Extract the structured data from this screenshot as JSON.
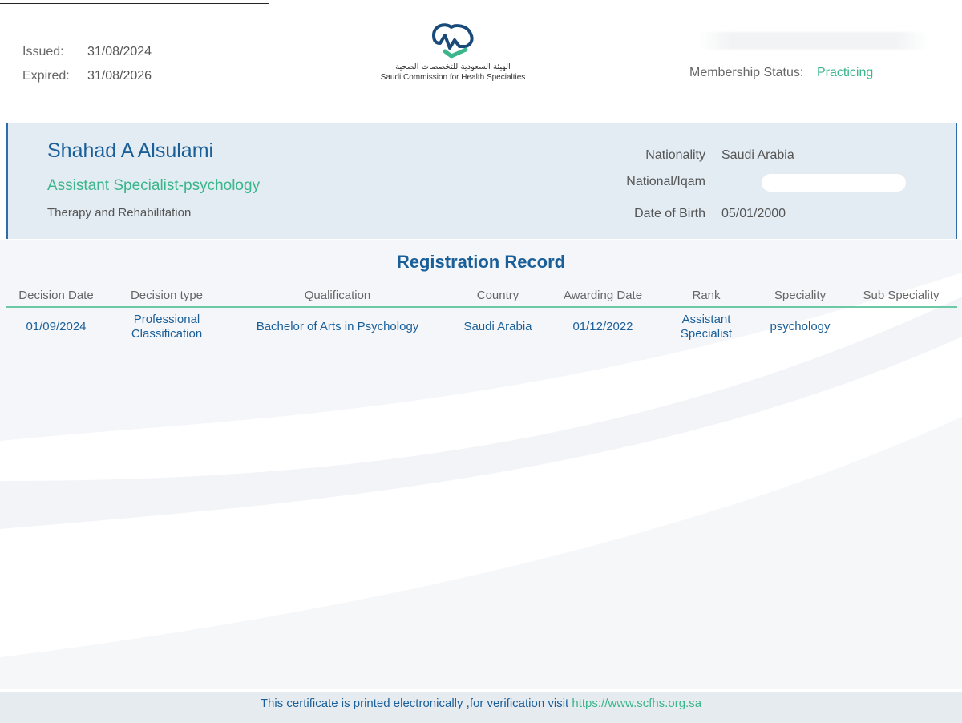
{
  "header": {
    "issued_label": "Issued:",
    "issued_value": "31/08/2024",
    "expired_label": "Expired:",
    "expired_value": "31/08/2026",
    "membership_label": "Membership Status:",
    "membership_value": "Practicing"
  },
  "logo": {
    "arabic_name": "الهيئة السعودية للتخصصات الصحية",
    "english_name": "Saudi Commission for Health Specialties"
  },
  "profile": {
    "name": "Shahad A Alsulami",
    "title": "Assistant Specialist-psychology",
    "department": "Therapy and Rehabilitation",
    "nationality_label": "Nationality",
    "nationality_value": "Saudi Arabia",
    "national_id_label": "National/Iqam",
    "dob_label": "Date of Birth",
    "dob_value": "05/01/2000"
  },
  "registration": {
    "title": "Registration Record",
    "columns": [
      "Decision Date",
      "Decision type",
      "Qualification",
      "Country",
      "Awarding Date",
      "Rank",
      "Speciality",
      "Sub Speciality"
    ],
    "rows": [
      [
        "01/09/2024",
        "Professional Classification",
        "Bachelor of Arts in Psychology",
        "Saudi Arabia",
        "01/12/2022",
        "Assistant Specialist",
        "psychology",
        ""
      ]
    ]
  },
  "footer": {
    "text": "This certificate is printed electronically ,for verification visit",
    "link": "https://www.scfhs.org.sa"
  },
  "colors": {
    "blue": "#1b5f99",
    "green": "#3bb58a",
    "panel": "#e3ecf3"
  }
}
